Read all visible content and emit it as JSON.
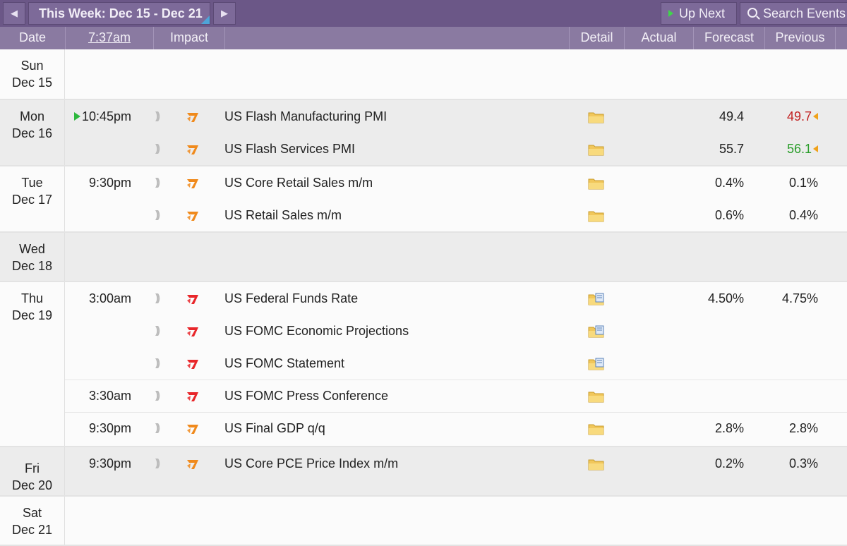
{
  "toolbar": {
    "prev_icon": "left-arrow-icon",
    "week_label": "This Week: Dec 15 - Dec 21",
    "next_icon": "right-arrow-icon",
    "up_next": "Up Next",
    "search": "Search Events"
  },
  "header": {
    "date": "Date",
    "time": "7:37am",
    "impact": "Impact",
    "detail": "Detail",
    "actual": "Actual",
    "forecast": "Forecast",
    "previous": "Previous"
  },
  "colors": {
    "topbar": "#6b5787",
    "header": "#8a7aa1",
    "high_impact": "#e8262a",
    "medium_impact": "#f08a1c",
    "better": "#2a9d2a",
    "worse": "#c21f1f"
  },
  "days": [
    {
      "dow": "Sun",
      "date": "Dec 15",
      "events": []
    },
    {
      "dow": "Mon",
      "date": "Dec 16",
      "events": [
        {
          "time": "10:45pm",
          "next": true,
          "impact": "medium",
          "title": "US Flash Manufacturing PMI",
          "detail": "folder",
          "actual": "",
          "forecast": "49.4",
          "previous": "49.7",
          "previous_status": "worse",
          "revised": true
        },
        {
          "time": "",
          "impact": "medium",
          "title": "US Flash Services PMI",
          "detail": "folder",
          "actual": "",
          "forecast": "55.7",
          "previous": "56.1",
          "previous_status": "better",
          "revised": true
        }
      ]
    },
    {
      "dow": "Tue",
      "date": "Dec 17",
      "events": [
        {
          "time": "9:30pm",
          "impact": "medium",
          "title": "US Core Retail Sales m/m",
          "detail": "folder",
          "actual": "",
          "forecast": "0.4%",
          "previous": "0.1%"
        },
        {
          "time": "",
          "impact": "medium",
          "title": "US Retail Sales m/m",
          "detail": "folder",
          "actual": "",
          "forecast": "0.6%",
          "previous": "0.4%"
        }
      ]
    },
    {
      "dow": "Wed",
      "date": "Dec 18",
      "events": []
    },
    {
      "dow": "Thu",
      "date": "Dec 19",
      "events": [
        {
          "time": "3:00am",
          "impact": "high",
          "title": "US Federal Funds Rate",
          "detail": "folder-doc",
          "actual": "",
          "forecast": "4.50%",
          "previous": "4.75%"
        },
        {
          "time": "",
          "impact": "high",
          "title": "US FOMC Economic Projections",
          "detail": "folder-doc",
          "actual": "",
          "forecast": "",
          "previous": ""
        },
        {
          "time": "",
          "impact": "high",
          "title": "US FOMC Statement",
          "detail": "folder-doc",
          "actual": "",
          "forecast": "",
          "previous": ""
        },
        {
          "time": "3:30am",
          "impact": "high",
          "title": "US FOMC Press Conference",
          "detail": "folder",
          "actual": "",
          "forecast": "",
          "previous": ""
        },
        {
          "time": "9:30pm",
          "impact": "medium",
          "title": "US Final GDP q/q",
          "detail": "folder",
          "actual": "",
          "forecast": "2.8%",
          "previous": "2.8%"
        }
      ]
    },
    {
      "dow": "Fri",
      "date": "Dec 20",
      "events": [
        {
          "time": "9:30pm",
          "impact": "medium",
          "title": "US Core PCE Price Index m/m",
          "detail": "folder",
          "actual": "",
          "forecast": "0.2%",
          "previous": "0.3%"
        }
      ]
    },
    {
      "dow": "Sat",
      "date": "Dec 21",
      "events": []
    }
  ]
}
